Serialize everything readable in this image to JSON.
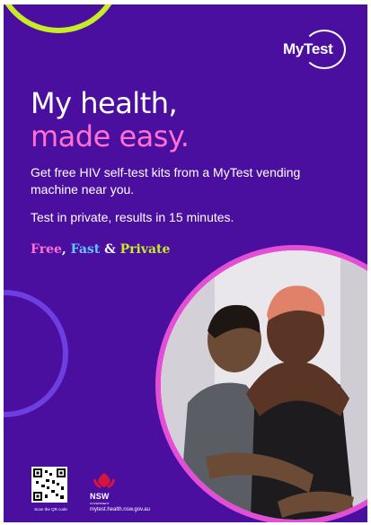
{
  "brand": {
    "logo_text": "MyTest",
    "colors": {
      "background": "#4b0fa0",
      "pink": "#ff70d0",
      "lime": "#c6ec26",
      "blue": "#5ec8ff",
      "ring": "#e24fd6"
    }
  },
  "headline": {
    "line1": "My health,",
    "line2": "made easy."
  },
  "body": {
    "paragraph1": "Get free HIV self-test kits from a MyTest vending machine near you.",
    "paragraph2": "Test in private, results in 15 minutes."
  },
  "tagline": {
    "free": "Free",
    "comma": ", ",
    "fast": "Fast",
    "amp": " & ",
    "private": "Private"
  },
  "footer": {
    "qr_caption": "Scan the QR code",
    "nsw_label": "NSW",
    "nsw_sub": "GOVERNMENT",
    "url": "mytest.health.nsw.gov.au"
  },
  "icons": {
    "logo": "mytest-logo-icon",
    "qr": "qr-code-icon",
    "nsw": "waratah-icon",
    "photo": "couple-photo"
  }
}
